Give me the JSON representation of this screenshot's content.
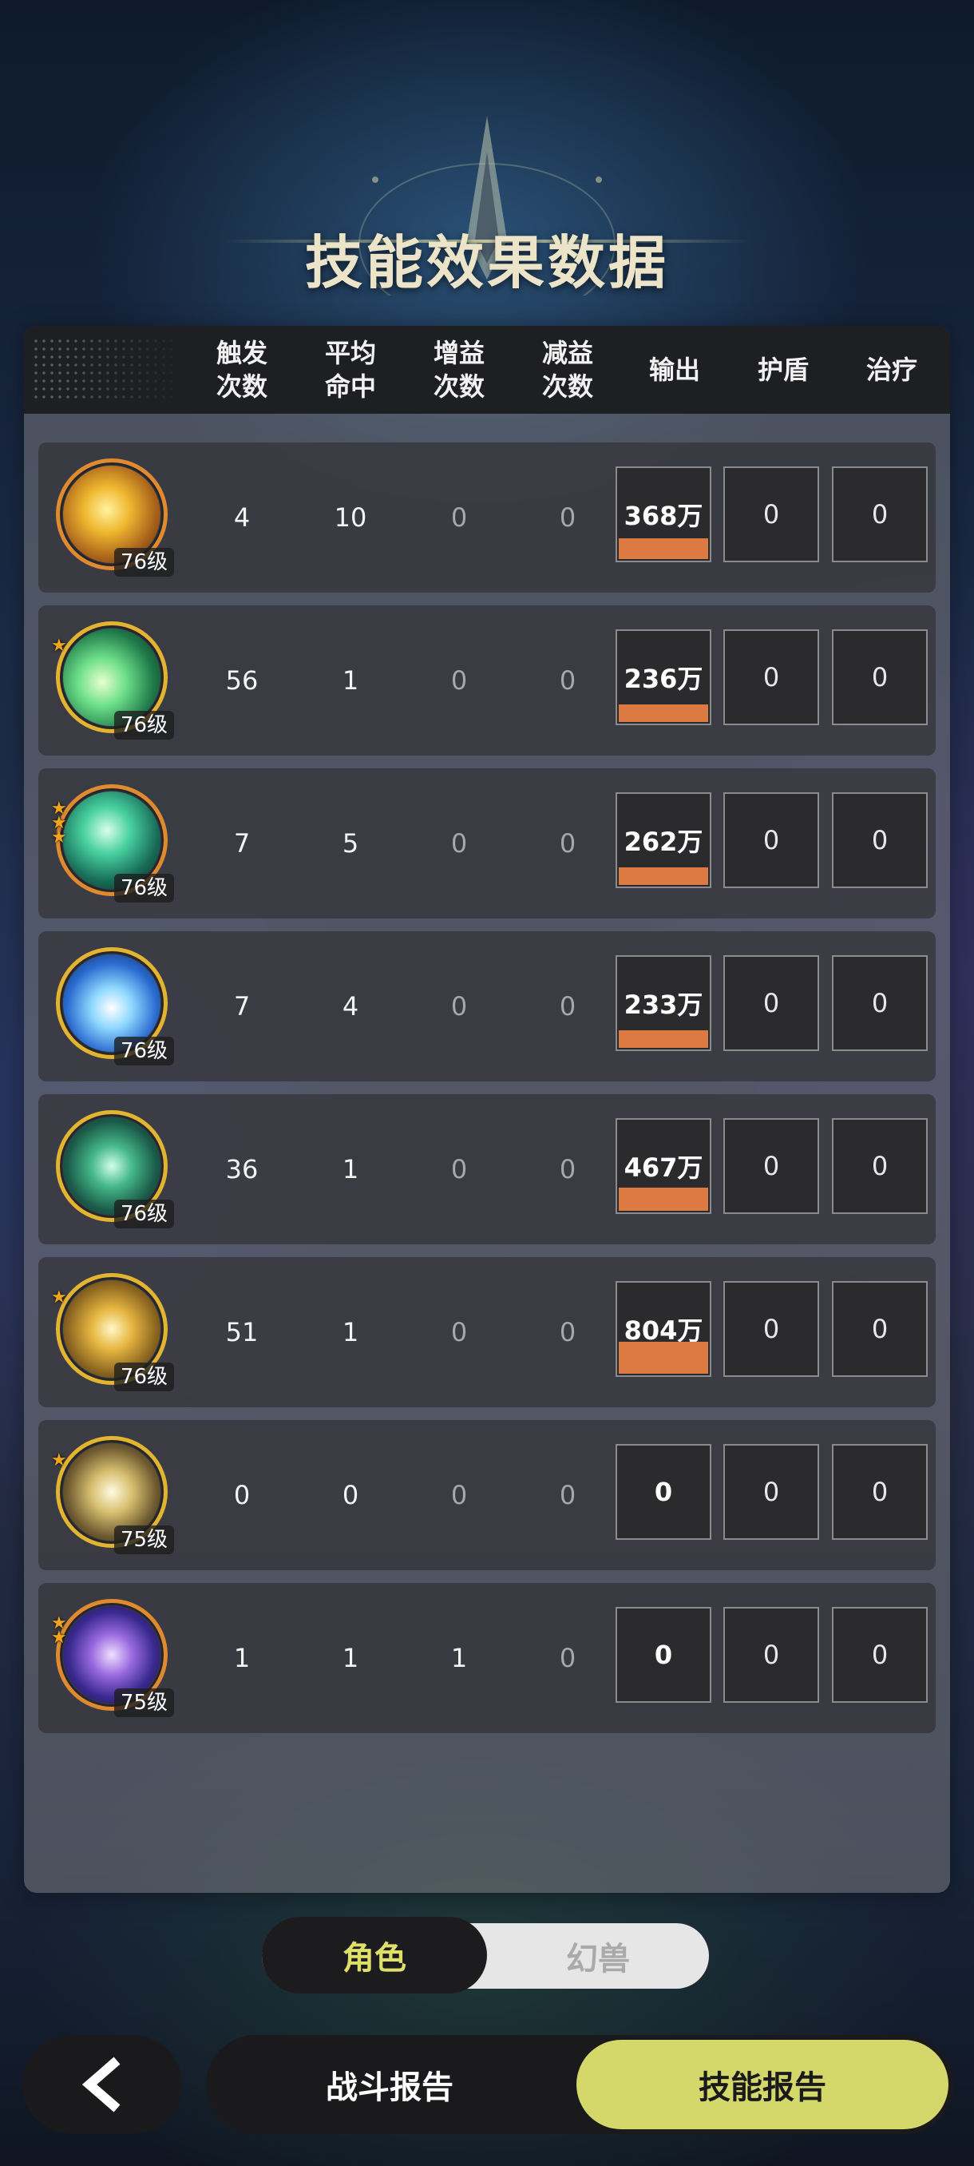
{
  "page": {
    "title": "技能效果数据"
  },
  "table": {
    "headers": [
      "触发\n次数",
      "平均\n命中",
      "增益\n次数",
      "减益\n次数",
      "输出",
      "护盾",
      "治疗"
    ],
    "max_output": 804,
    "rows": [
      {
        "level": "76级",
        "stars": 0,
        "ring": "orange",
        "icon": "lightning-skill-icon",
        "trigger": "4",
        "hit": "10",
        "buff": "0",
        "debuff": "0",
        "output": "368万",
        "output_value": 368,
        "shield": "0",
        "heal": "0"
      },
      {
        "level": "76级",
        "stars": 1,
        "ring": "gold",
        "icon": "green-slash-skill-icon",
        "trigger": "56",
        "hit": "1",
        "buff": "0",
        "debuff": "0",
        "output": "236万",
        "output_value": 236,
        "shield": "0",
        "heal": "0"
      },
      {
        "level": "76级",
        "stars": 3,
        "ring": "orange",
        "icon": "green-wave-skill-icon",
        "trigger": "7",
        "hit": "5",
        "buff": "0",
        "debuff": "0",
        "output": "262万",
        "output_value": 262,
        "shield": "0",
        "heal": "0"
      },
      {
        "level": "76级",
        "stars": 0,
        "ring": "gold",
        "icon": "ice-burst-skill-icon",
        "trigger": "7",
        "hit": "4",
        "buff": "0",
        "debuff": "0",
        "output": "233万",
        "output_value": 233,
        "shield": "0",
        "heal": "0"
      },
      {
        "level": "76级",
        "stars": 0,
        "ring": "gold",
        "icon": "green-orb-skill-icon",
        "trigger": "36",
        "hit": "1",
        "buff": "0",
        "debuff": "0",
        "output": "467万",
        "output_value": 467,
        "shield": "0",
        "heal": "0"
      },
      {
        "level": "76级",
        "stars": 1,
        "ring": "gold",
        "icon": "golden-burst-skill-icon",
        "trigger": "51",
        "hit": "1",
        "buff": "0",
        "debuff": "0",
        "output": "804万",
        "output_value": 804,
        "shield": "0",
        "heal": "0"
      },
      {
        "level": "75级",
        "stars": 1,
        "ring": "gold",
        "icon": "golden-arrow-skill-icon",
        "trigger": "0",
        "hit": "0",
        "buff": "0",
        "debuff": "0",
        "output": "0",
        "output_value": 0,
        "shield": "0",
        "heal": "0"
      },
      {
        "level": "75级",
        "stars": 2,
        "ring": "orange",
        "icon": "purple-sphere-skill-icon",
        "trigger": "1",
        "hit": "1",
        "buff": "1",
        "debuff": "0",
        "output": "0",
        "output_value": 0,
        "shield": "0",
        "heal": "0"
      }
    ]
  },
  "toggle": {
    "active": "角色",
    "inactive": "幻兽"
  },
  "nav": {
    "back_icon": "chevron-left-icon",
    "battle_report": "战斗报告",
    "skill_report": "技能报告"
  },
  "colors": {
    "bar": "#dd7a44",
    "active_tab": "#d4d86a",
    "active_text": "#dfe06a"
  }
}
